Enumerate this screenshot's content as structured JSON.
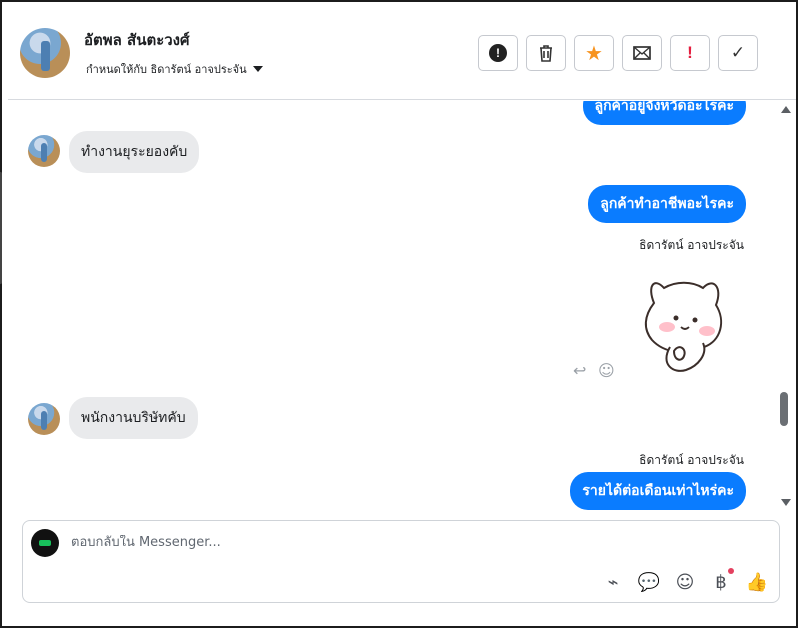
{
  "header": {
    "name": "อัตพล สันตะวงศ์",
    "assign_label": "กำหนดให้กับ ธิดารัตน์ อาจประจัน",
    "actions": [
      {
        "name": "report-button",
        "icon": "!"
      },
      {
        "name": "delete-button",
        "icon": "🗑"
      },
      {
        "name": "star-button",
        "icon": "★"
      },
      {
        "name": "unread-button",
        "icon": "✉"
      },
      {
        "name": "important-button",
        "icon": "!"
      },
      {
        "name": "done-button",
        "icon": "✓"
      }
    ]
  },
  "messages": [
    {
      "type": "out",
      "text": "ลูกค้าอยู่จังหวัดอะไรคะ"
    },
    {
      "type": "in",
      "text": "ทำงานยุระยองคับ"
    },
    {
      "type": "out",
      "text": "ลูกค้าทำอาชีพอะไรคะ"
    },
    {
      "type": "sender",
      "text": "ธิดารัตน์ อาจประจัน"
    },
    {
      "type": "in",
      "text": "พนักงานบริษัทคับ"
    },
    {
      "type": "sender",
      "text": "ธิดารัตน์ อาจประจัน"
    },
    {
      "type": "out",
      "text": "รายได้ต่อเดือนเท่าไหร่คะ"
    }
  ],
  "composer": {
    "placeholder": "ตอบกลับใน Messenger...",
    "tools": [
      "paperclip-icon",
      "speech-bubble-icon",
      "smiley-icon",
      "baht-icon",
      "thumbs-up-icon"
    ]
  },
  "colors": {
    "accent": "#0a7cff",
    "incoming": "#e9eaec",
    "star": "#f7931e",
    "alert": "#e41e3f"
  }
}
